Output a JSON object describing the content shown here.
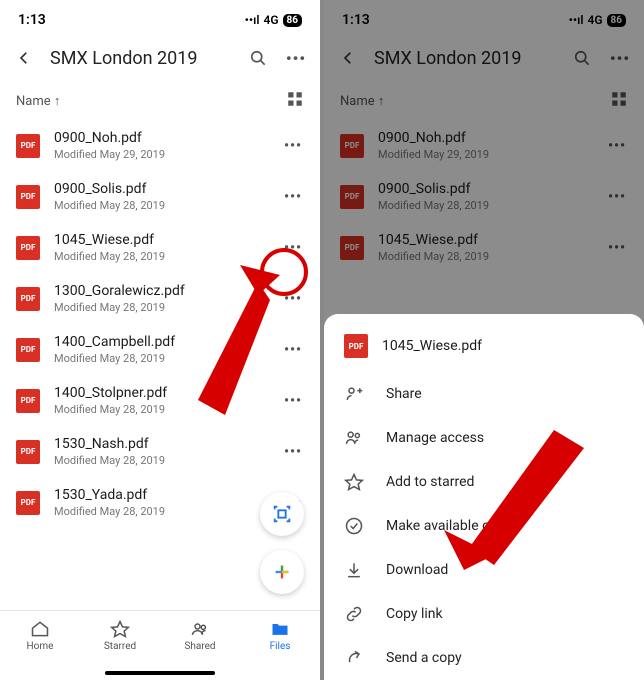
{
  "status": {
    "time": "1:13",
    "network": "4G",
    "battery": "86"
  },
  "folder_title": "SMX London 2019",
  "sort_label": "Name ↑",
  "pdf_badge": "PDF",
  "files": [
    {
      "name": "0900_Noh.pdf",
      "meta": "Modified May 29, 2019"
    },
    {
      "name": "0900_Solis.pdf",
      "meta": "Modified May 28, 2019"
    },
    {
      "name": "1045_Wiese.pdf",
      "meta": "Modified May 28, 2019"
    },
    {
      "name": "1300_Goralewicz.pdf",
      "meta": "Modified May 28, 2019"
    },
    {
      "name": "1400_Campbell.pdf",
      "meta": "Modified May 28, 2019"
    },
    {
      "name": "1400_Stolpner.pdf",
      "meta": "Modified May 28, 2019"
    },
    {
      "name": "1530_Nash.pdf",
      "meta": "Modified May 28, 2019"
    },
    {
      "name": "1530_Yada.pdf",
      "meta": "Modified May 28, 2019"
    }
  ],
  "files_short": [
    {
      "name": "0900_Noh.pdf",
      "meta": "Modified May 29, 2019"
    },
    {
      "name": "0900_Solis.pdf",
      "meta": "Modified May 28, 2019"
    },
    {
      "name": "1045_Wiese.pdf",
      "meta": "Modified May 28, 2019"
    }
  ],
  "nav": {
    "home": "Home",
    "starred": "Starred",
    "shared": "Shared",
    "files": "Files"
  },
  "sheet": {
    "file": "1045_Wiese.pdf",
    "items": {
      "share": "Share",
      "manage_access": "Manage access",
      "add_starred": "Add to starred",
      "offline": "Make available offline",
      "download": "Download",
      "copy_link": "Copy link",
      "send_copy": "Send a copy"
    }
  }
}
